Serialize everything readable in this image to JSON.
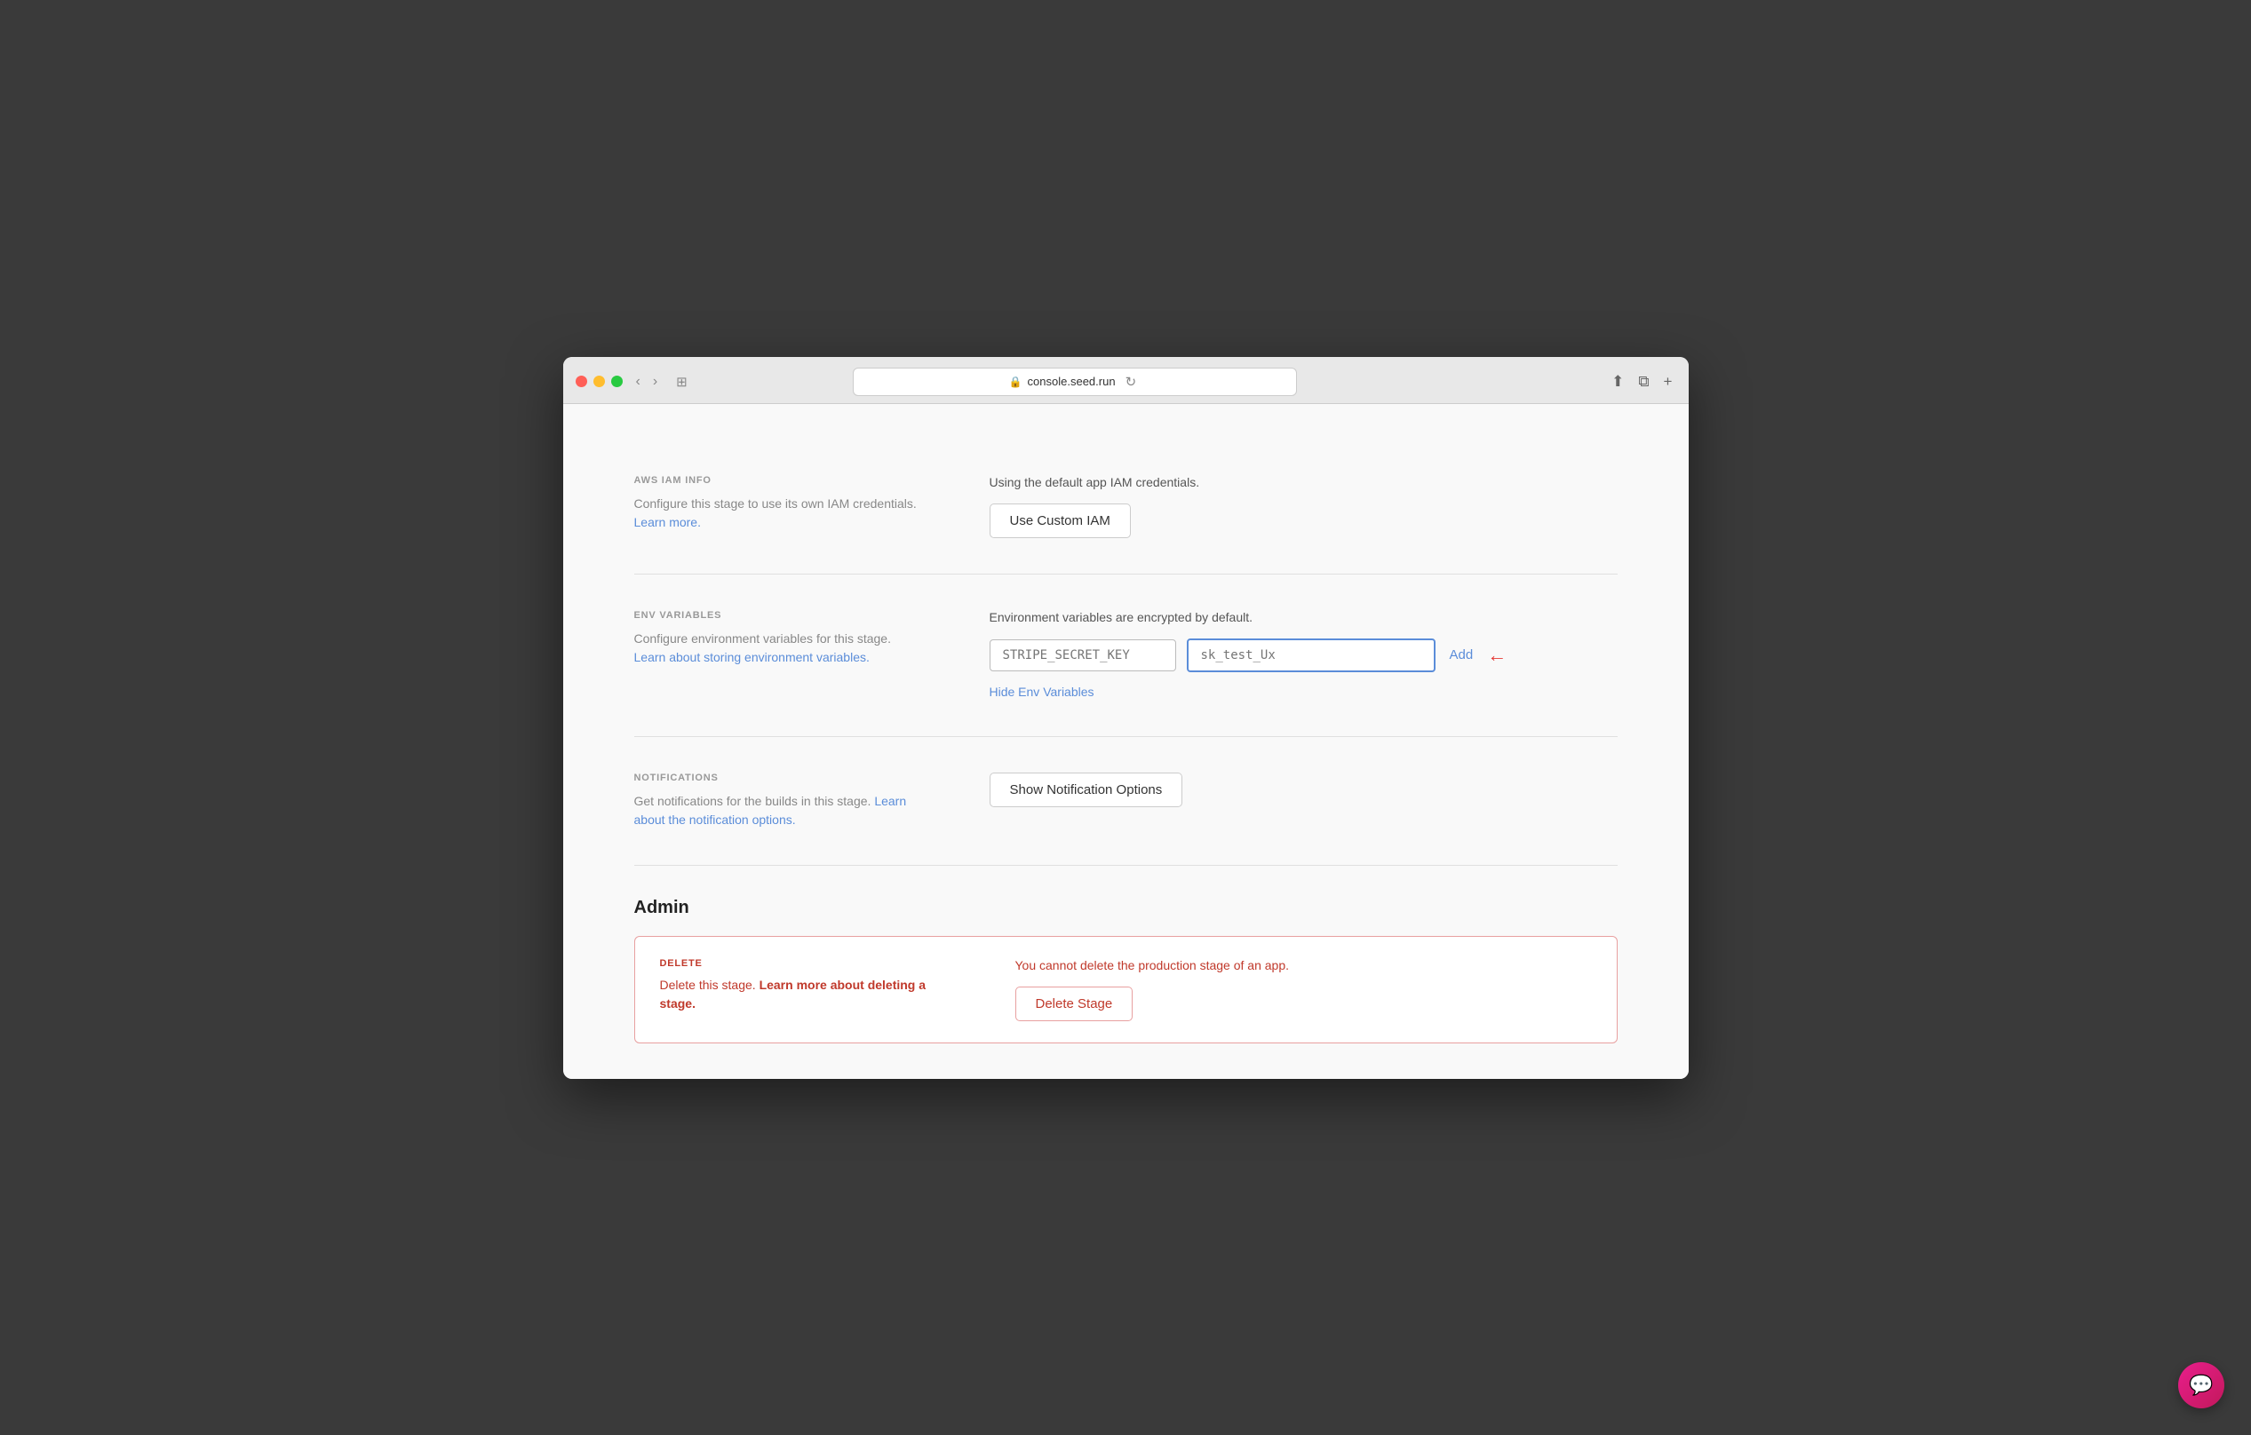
{
  "browser": {
    "url": "console.seed.run",
    "back_label": "‹",
    "forward_label": "›",
    "tab_label": "⊞",
    "refresh_label": "↻",
    "share_label": "⬆",
    "newwindow_label": "⧉",
    "add_tab_label": "+"
  },
  "iam_section": {
    "title": "AWS IAM INFO",
    "desc": "Configure this stage to use its own IAM credentials.",
    "learn_more": "Learn more.",
    "status": "Using the default app IAM credentials.",
    "button_label": "Use Custom IAM"
  },
  "env_section": {
    "title": "ENV VARIABLES",
    "desc": "Configure environment variables for this stage.",
    "learn_link": "Learn about storing environment variables.",
    "encrypted_note": "Environment variables are encrypted by default.",
    "key_placeholder": "STRIPE_SECRET_KEY",
    "value_placeholder": "sk_test_Ux",
    "add_label": "Add",
    "hide_label": "Hide Env Variables"
  },
  "notifications_section": {
    "title": "NOTIFICATIONS",
    "desc": "Get notifications for the builds in this stage.",
    "learn_link": "Learn about the notification options.",
    "button_label": "Show Notification Options"
  },
  "admin_section": {
    "title": "Admin",
    "delete_title": "DELETE",
    "delete_desc": "Delete this stage.",
    "delete_learn_link": "Learn more about deleting a stage.",
    "delete_warning": "You cannot delete the production stage of an app.",
    "delete_button_label": "Delete Stage"
  }
}
